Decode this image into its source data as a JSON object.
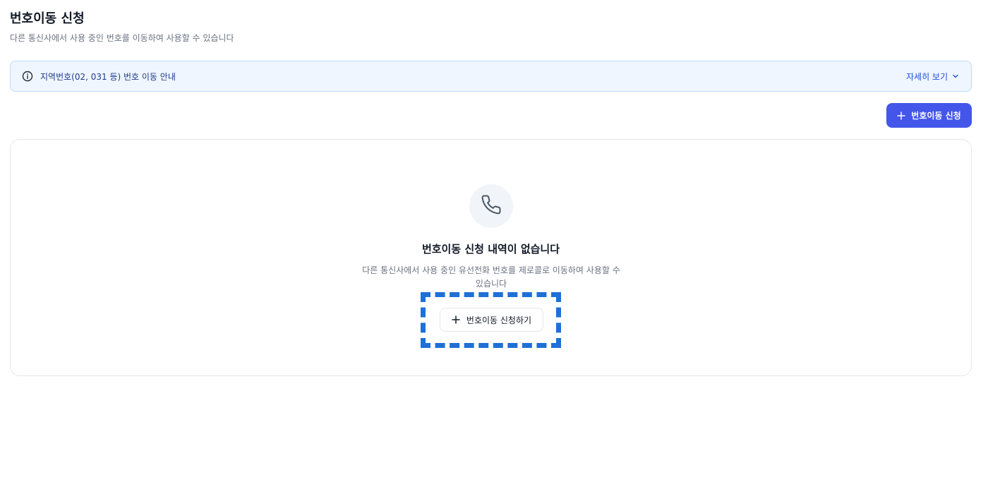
{
  "header": {
    "title": "번호이동 신청",
    "subtitle": "다른 통신사에서 사용 중인 번호를 이동하여 사용할 수 있습니다"
  },
  "notice": {
    "icon": "info-icon",
    "text": "지역번호(02, 031 등) 번호 이동 안내",
    "toggle_label": "자세히 보기",
    "toggle_icon": "chevron-down-icon"
  },
  "toolbar": {
    "apply_button_label": "번호이동 신청",
    "apply_button_icon": "plus-icon"
  },
  "empty_state": {
    "icon": "phone-icon",
    "title": "번호이동 신청 내역이 없습니다",
    "description": "다른 통신사에서 사용 중인 유선전화 번호를 제로콜로 이동하여 사용할 수 있습니다",
    "button_label": "번호이동 신청하기",
    "button_icon": "plus-icon"
  },
  "colors": {
    "primary": "#4456ea",
    "notice_bg": "#eff6ff",
    "notice_text": "#1e3a8a",
    "highlight": "#1f6fd6"
  }
}
